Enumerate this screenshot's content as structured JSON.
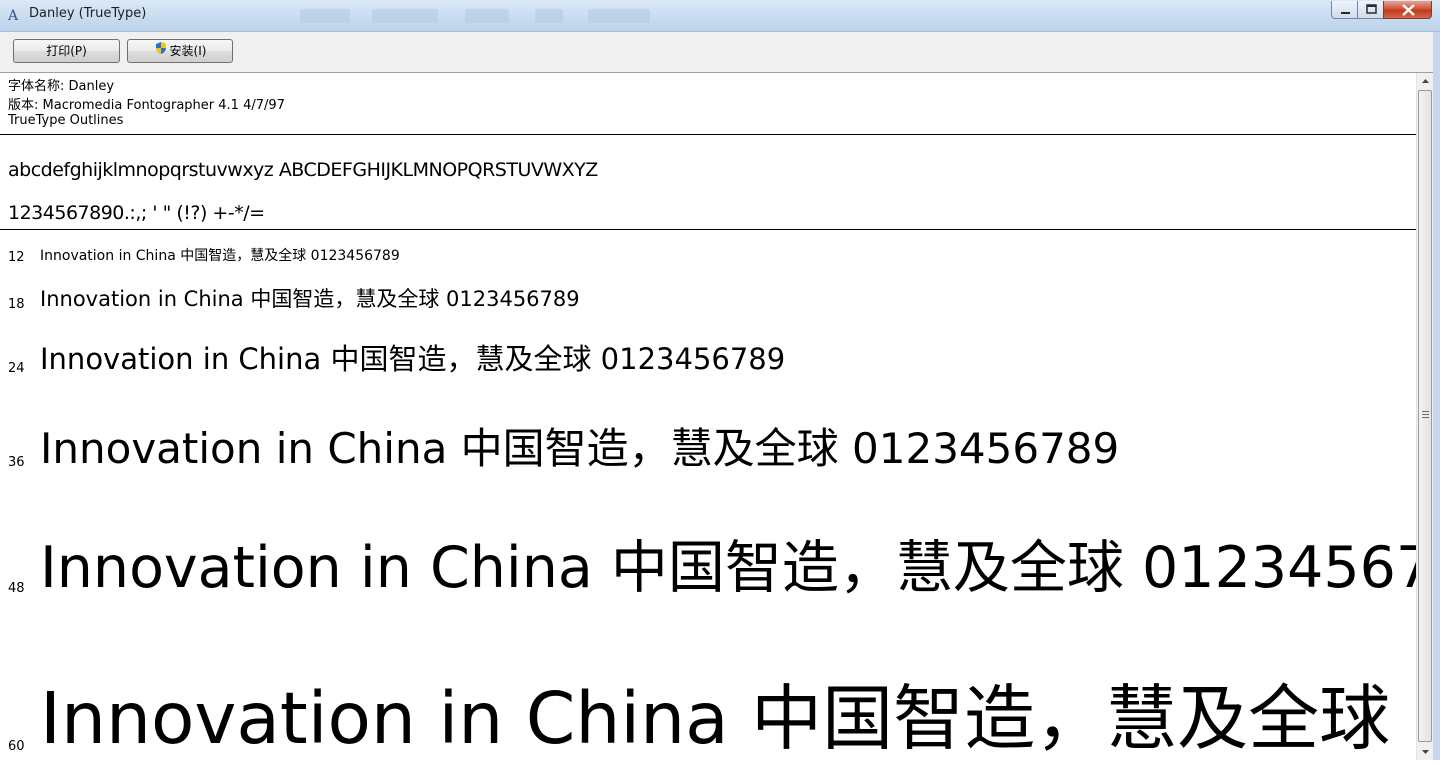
{
  "window": {
    "title": "Danley (TrueType)"
  },
  "toolbar": {
    "print_label": "打印(P)",
    "install_label": "安装(I)"
  },
  "font_info": {
    "name_line": "字体名称: Danley",
    "version_line": "版本: Macromedia Fontographer 4.1 4/7/97",
    "type_line": "TrueType Outlines"
  },
  "charset": {
    "letters": "abcdefghijklmnopqrstuvwxyz ABCDEFGHIJKLMNOPQRSTUVWXYZ",
    "symbols": "1234567890.:,; ' \" (!?) +-*/="
  },
  "samples": {
    "text": "Innovation in China 中国智造，慧及全球 0123456789",
    "rows": [
      {
        "size": "12"
      },
      {
        "size": "18"
      },
      {
        "size": "24"
      },
      {
        "size": "36"
      },
      {
        "size": "48"
      },
      {
        "size": "60"
      }
    ]
  }
}
